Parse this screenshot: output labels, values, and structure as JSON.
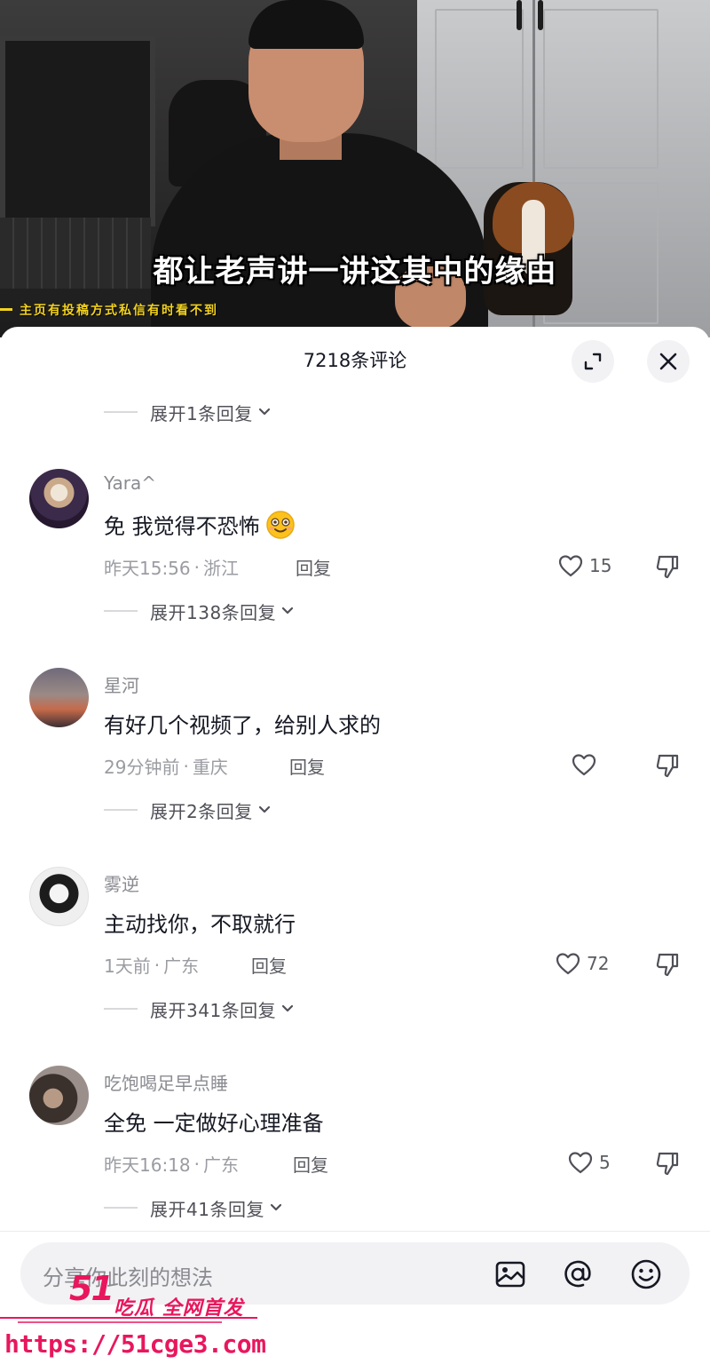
{
  "video": {
    "subtitle": "都让老声讲一讲这其中的缘由",
    "banner": "主页有投稿方式私信有时看不到"
  },
  "header": {
    "title": "7218条评论",
    "expand_icon": "expand-icon",
    "close_icon": "close-icon"
  },
  "top_reply": {
    "label": "展开1条回复"
  },
  "comments": [
    {
      "user": "Yara^",
      "text": "免 我觉得不恐怖",
      "emoji": "smiling-face-emoji",
      "time": "昨天15:56",
      "location": "浙江",
      "reply_label": "回复",
      "likes": "15",
      "expand_replies": "展开138条回复"
    },
    {
      "user": "星河",
      "text": "有好几个视频了，给别人求的",
      "time": "29分钟前",
      "location": "重庆",
      "reply_label": "回复",
      "likes": "",
      "expand_replies": "展开2条回复"
    },
    {
      "user": "雾逆",
      "text": "主动找你，不取就行",
      "time": "1天前",
      "location": "广东",
      "reply_label": "回复",
      "likes": "72",
      "expand_replies": "展开341条回复"
    },
    {
      "user": "吃饱喝足早点睡",
      "text": "全免 一定做好心理准备",
      "time": "昨天16:18",
      "location": "广东",
      "reply_label": "回复",
      "likes": "5",
      "expand_replies": "展开41条回复"
    }
  ],
  "meta_separator": "·",
  "input": {
    "placeholder": "分享你此刻的想法",
    "icons": [
      "image-icon",
      "at-icon",
      "emoji-icon"
    ]
  },
  "watermark": {
    "logo": "51",
    "tagline": "吃瓜 全网首发",
    "url": "https://51cge3.com"
  },
  "colors": {
    "text_primary": "#161823",
    "text_secondary": "#8a8b91",
    "watermark": "#e8175d",
    "subtitle_banner": "#f2d21f"
  }
}
